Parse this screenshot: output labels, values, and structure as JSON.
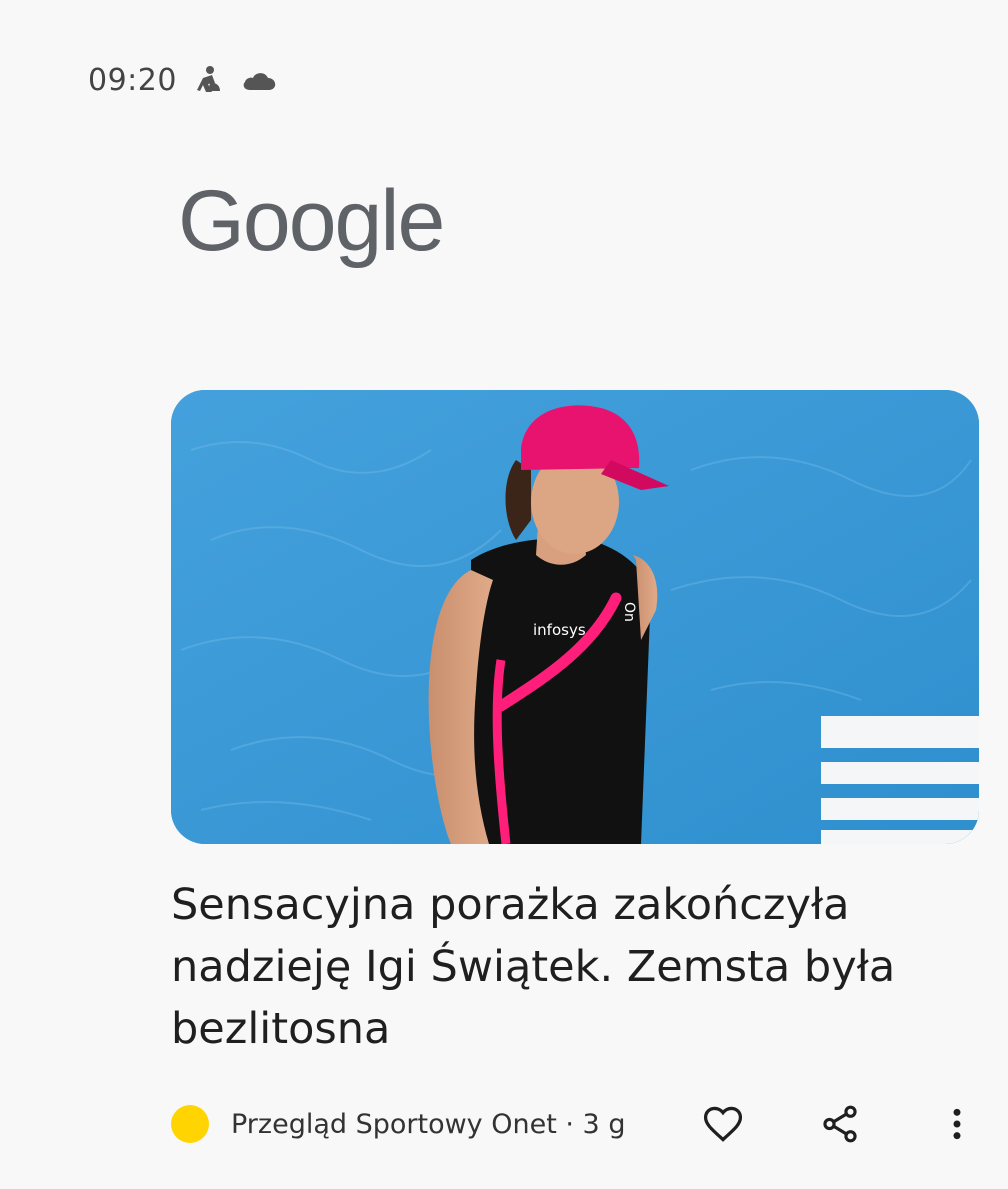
{
  "status_bar": {
    "time": "09:20",
    "icons": [
      "figure-icon",
      "cloud-icon"
    ]
  },
  "logo": {
    "text": "Google"
  },
  "article": {
    "headline": "Sensacyjna porażka zakończyła nadzieję Igi Świątek. Zemsta była bezlitosna",
    "source_line": "Przegląd Sportowy Onet · 3 g",
    "source_color": "#ffd400",
    "image_text": {
      "jersey_sponsor": "infosys",
      "jersey_brand": "On"
    },
    "actions": [
      "heart-icon",
      "share-icon",
      "more-vert-icon"
    ]
  }
}
